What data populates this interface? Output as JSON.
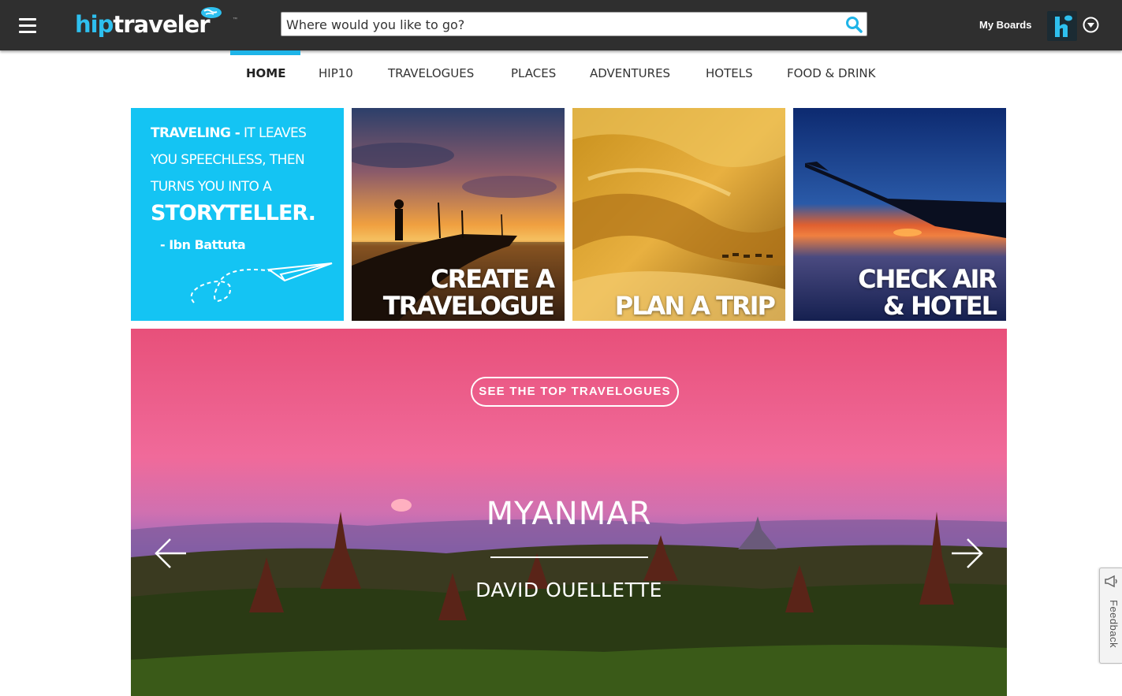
{
  "header": {
    "logo": {
      "part1": "hip",
      "part2": "traveler",
      "tm": "™"
    },
    "search": {
      "placeholder": "Where would you like to go?"
    },
    "my_boards": "My Boards"
  },
  "nav": {
    "items": [
      {
        "label": "HOME",
        "active": true
      },
      {
        "label": "HIP10"
      },
      {
        "label": "TRAVELOGUES"
      },
      {
        "label": "PLACES"
      },
      {
        "label": "ADVENTURES"
      },
      {
        "label": "HOTELS"
      },
      {
        "label": "FOOD & DRINK"
      }
    ]
  },
  "quote": {
    "line1_bold": "TRAVELING -",
    "line1_rest": " IT LEAVES",
    "line2": "YOU SPEECHLESS, THEN",
    "line3": "TURNS YOU INTO A",
    "line4": "STORYTELLER.",
    "author": "- Ibn Battuta"
  },
  "tiles": [
    {
      "label_line1": "CREATE A",
      "label_line2": "TRAVELOGUE"
    },
    {
      "label_line1": "PLAN A TRIP"
    },
    {
      "label_line1": "CHECK AIR",
      "label_line2": "& HOTEL"
    }
  ],
  "hero": {
    "cta": "SEE THE TOP TRAVELOGUES",
    "title": "MYANMAR",
    "author": "DAVID OUELLETTE"
  },
  "feedback": {
    "label": "Feedback"
  },
  "colors": {
    "accent": "#14c4f3",
    "topbar": "#2f2f2f",
    "nav_active": "#1eb4e8"
  }
}
